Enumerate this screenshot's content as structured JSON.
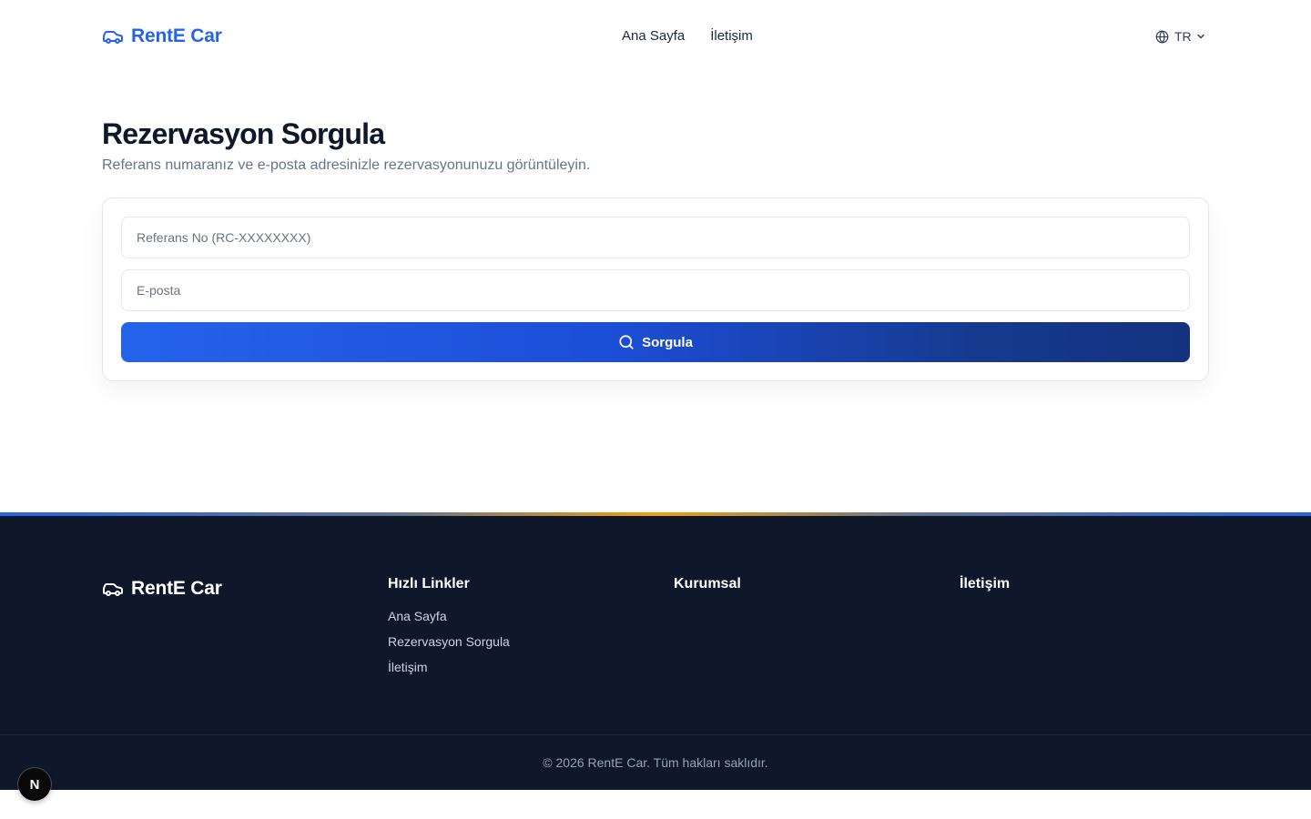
{
  "header": {
    "brand": "RentE Car",
    "nav": [
      {
        "label": "Ana Sayfa"
      },
      {
        "label": "İletişim"
      }
    ],
    "language": "TR"
  },
  "main": {
    "title": "Rezervasyon Sorgula",
    "subtitle": "Referans numaranız ve e-posta adresinizle rezervasyonunuzu görüntüleyin.",
    "form": {
      "reference_placeholder": "Referans No (RC-XXXXXXXX)",
      "reference_value": "",
      "email_placeholder": "E-posta",
      "email_value": "",
      "submit_label": "Sorgula"
    }
  },
  "footer": {
    "brand": "RentE Car",
    "columns": [
      {
        "title": "Hızlı Linkler",
        "links": [
          "Ana Sayfa",
          "Rezervasyon Sorgula",
          "İletişim"
        ]
      },
      {
        "title": "Kurumsal",
        "links": []
      },
      {
        "title": "İletişim",
        "links": []
      }
    ],
    "copyright": "© 2026 RentE Car. Tüm hakları saklıdır."
  },
  "badge": {
    "letter": "N"
  },
  "colors": {
    "brand": "#2563eb",
    "footer_bg": "#0f172a",
    "button_gradient_end": "#14327e",
    "accent": "#f59e0b"
  },
  "icons": {
    "logo": "car-icon",
    "language": "globe-icon",
    "language_toggle": "chevron-down-icon",
    "submit": "search-icon"
  }
}
